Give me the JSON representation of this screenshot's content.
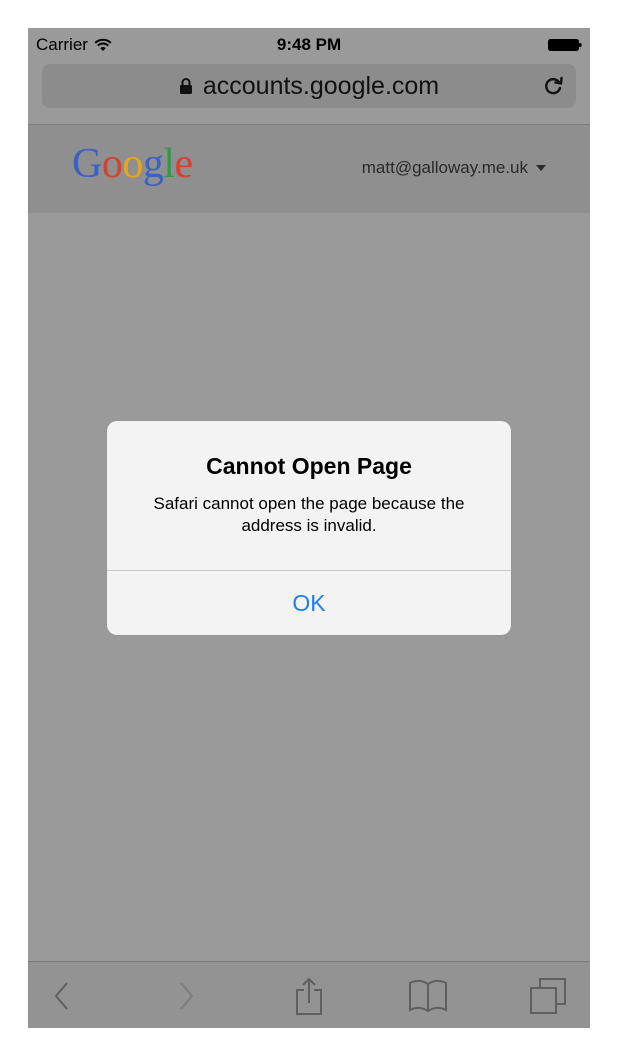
{
  "status_bar": {
    "carrier": "Carrier",
    "time": "9:48 PM"
  },
  "address_bar": {
    "url": "accounts.google.com"
  },
  "google_header": {
    "logo_letters": [
      "G",
      "o",
      "o",
      "g",
      "l",
      "e"
    ],
    "logo_colors": [
      "#3a61c6",
      "#d7402c",
      "#e8a51a",
      "#3a61c6",
      "#2f9b46",
      "#d7402c"
    ],
    "account_email": "matt@galloway.me.uk"
  },
  "alert": {
    "title": "Cannot Open Page",
    "message": "Safari cannot open the page because the address is invalid.",
    "ok_label": "OK"
  },
  "toolbar": {
    "items": [
      "back-icon",
      "forward-icon",
      "share-icon",
      "bookmarks-icon",
      "tabs-icon"
    ]
  },
  "colors": {
    "accent": "#1f7ef0",
    "dim_background": "#9a9a9a"
  }
}
